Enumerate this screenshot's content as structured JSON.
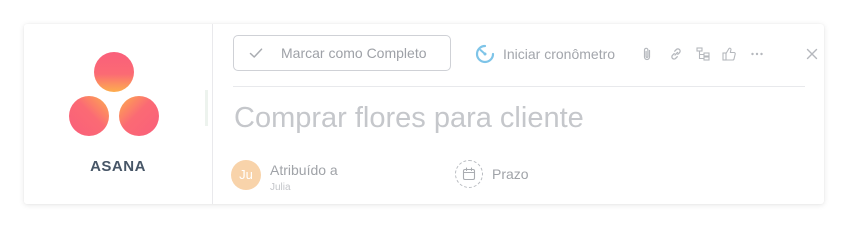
{
  "brand": {
    "name": "ASANA",
    "colors": {
      "gradient_start": "#fa5f7b",
      "gradient_end": "#fdae4e"
    }
  },
  "toolbar": {
    "complete_label": "Marcar como Completo",
    "timer_label": "Iniciar cronômetro",
    "icons": [
      "paperclip-icon",
      "link-icon",
      "subtask-icon",
      "thumbs-up-icon",
      "more-icon",
      "close-icon"
    ]
  },
  "task": {
    "title": "Comprar flores para cliente",
    "assignee": {
      "label": "Atribuído a",
      "initials": "Ju",
      "name": "Julia"
    },
    "due": {
      "label": "Prazo"
    }
  },
  "colors": {
    "text_muted": "#a0a3a8",
    "border": "#cfd1d6",
    "timer_accent": "#7ec4e8",
    "avatar_bg": "#f8d3aa"
  }
}
